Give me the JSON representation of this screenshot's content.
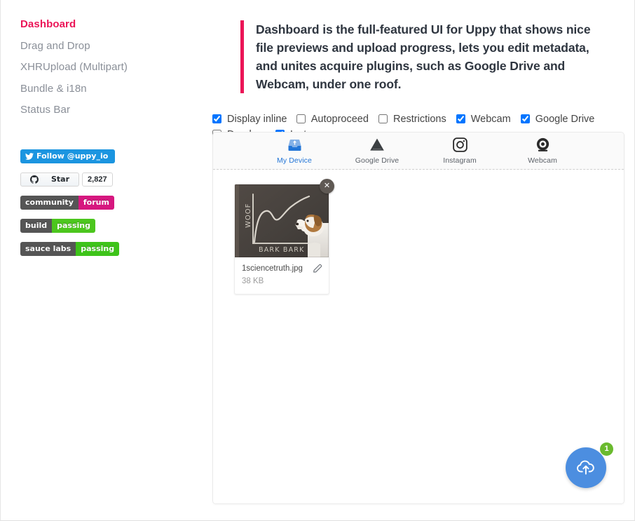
{
  "sidebar": {
    "nav": [
      {
        "label": "Dashboard",
        "active": true
      },
      {
        "label": "Drag and Drop",
        "active": false
      },
      {
        "label": "XHRUpload (Multipart)",
        "active": false
      },
      {
        "label": "Bundle & i18n",
        "active": false
      },
      {
        "label": "Status Bar",
        "active": false
      }
    ],
    "badges": {
      "twitter": {
        "label": "Follow @uppy_io",
        "icon": "twitter-icon",
        "color": "#1b95e0"
      },
      "github": {
        "label": "Star",
        "count": "2,827",
        "icon": "github-icon"
      },
      "community": {
        "left": "community",
        "right": "forum",
        "color": "#d6177f"
      },
      "build": {
        "left": "build",
        "right": "passing",
        "color": "#4cc61e"
      },
      "sauce": {
        "left": "sauce labs",
        "right": "passing",
        "color": "#3ec31a"
      }
    }
  },
  "main": {
    "description": "Dashboard is the full-featured UI for Uppy that shows nice file previews and upload progress, lets you edit metadata, and unites acquire plugins, such as Google Drive and Webcam, under one roof.",
    "accent_color": "#eb1557",
    "options": [
      {
        "label": "Display inline",
        "checked": true
      },
      {
        "label": "Autoproceed",
        "checked": false
      },
      {
        "label": "Restrictions",
        "checked": false
      },
      {
        "label": "Webcam",
        "checked": true
      },
      {
        "label": "Google Drive",
        "checked": true
      },
      {
        "label": "Dropbox",
        "checked": false
      },
      {
        "label": "Instagram",
        "checked": true
      }
    ]
  },
  "dashboard": {
    "tabs": [
      {
        "label": "My Device",
        "icon": "device-upload-icon",
        "active": true
      },
      {
        "label": "Google Drive",
        "icon": "google-drive-icon",
        "active": false
      },
      {
        "label": "Instagram",
        "icon": "instagram-icon",
        "active": false
      },
      {
        "label": "Webcam",
        "icon": "webcam-icon",
        "active": false
      }
    ],
    "active_tab_color": "#2275d7",
    "files": [
      {
        "name": "1sciencetruth.jpg",
        "size": "38 KB",
        "remove_icon": "close-icon",
        "edit_icon": "pencil-icon",
        "thumbnail": {
          "description": "Dog in a white lab coat standing at a chalkboard with a chalk line graph",
          "y_axis_label": "WOOF",
          "x_axis_label": "BARK BARK"
        }
      }
    ],
    "upload": {
      "icon": "cloud-upload-icon",
      "badge_count": "1",
      "button_color": "#4c8ee0",
      "badge_color": "#6aba2e"
    }
  }
}
